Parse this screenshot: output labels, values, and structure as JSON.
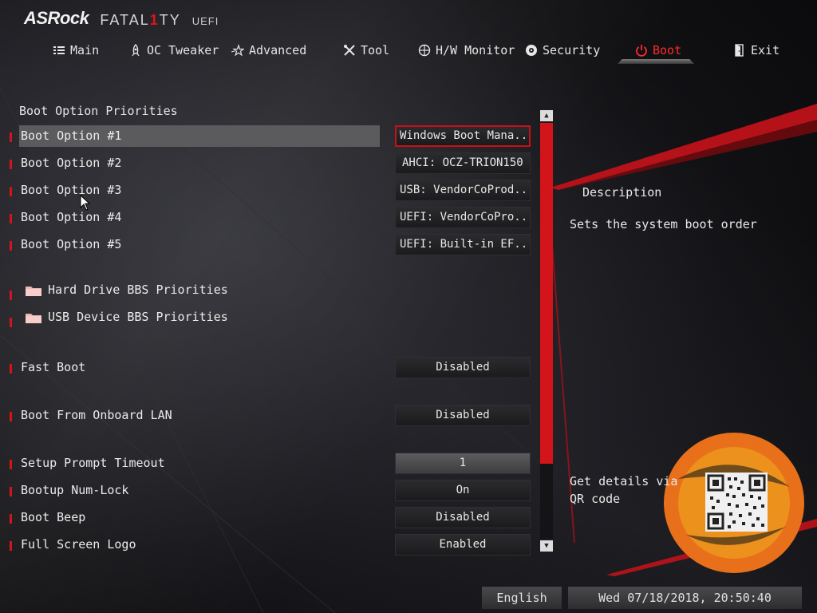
{
  "brand": {
    "maker": "ASRock",
    "series_a": "FATAL",
    "series_one": "1",
    "series_b": "TY",
    "uefi": "UEFI"
  },
  "nav": {
    "active": "Boot",
    "tabs": [
      {
        "label": "Main",
        "icon": "list-icon"
      },
      {
        "label": "OC Tweaker",
        "icon": "rocket-icon"
      },
      {
        "label": "Advanced",
        "icon": "star-icon"
      },
      {
        "label": "Tool",
        "icon": "tools-icon"
      },
      {
        "label": "H/W Monitor",
        "icon": "crosshair-icon"
      },
      {
        "label": "Security",
        "icon": "shield-gear-icon"
      },
      {
        "label": "Boot",
        "icon": "power-icon"
      },
      {
        "label": "Exit",
        "icon": "exit-door-icon"
      }
    ]
  },
  "main": {
    "section_title": "Boot Option Priorities",
    "boot_options": [
      {
        "label": "Boot Option #1",
        "value": "Windows Boot Mana..."
      },
      {
        "label": "Boot Option #2",
        "value": "AHCI:  OCZ-TRION150"
      },
      {
        "label": "Boot Option #3",
        "value": "USB: VendorCoProd..."
      },
      {
        "label": "Boot Option #4",
        "value": "UEFI: VendorCoPro..."
      },
      {
        "label": "Boot Option #5",
        "value": "UEFI: Built-in EF..."
      }
    ],
    "submenus": [
      {
        "label": "Hard Drive BBS Priorities"
      },
      {
        "label": "USB Device BBS Priorities"
      }
    ],
    "settings": [
      {
        "label": "Fast Boot",
        "value": "Disabled"
      },
      {
        "label": "Boot From Onboard LAN",
        "value": "Disabled"
      },
      {
        "label": "Setup Prompt Timeout",
        "value": "1"
      },
      {
        "label": "Bootup Num-Lock",
        "value": "On"
      },
      {
        "label": "Boot Beep",
        "value": "Disabled"
      },
      {
        "label": "Full Screen Logo",
        "value": "Enabled"
      }
    ]
  },
  "description": {
    "title": "Description",
    "text": "Sets the system boot order",
    "qr_text": "Get details via QR code"
  },
  "footer": {
    "language": "English",
    "datetime": "Wed 07/18/2018, 20:50:40"
  },
  "colors": {
    "accent": "#d4141c",
    "highlight": "#5b5b5e",
    "text": "#ececec"
  }
}
